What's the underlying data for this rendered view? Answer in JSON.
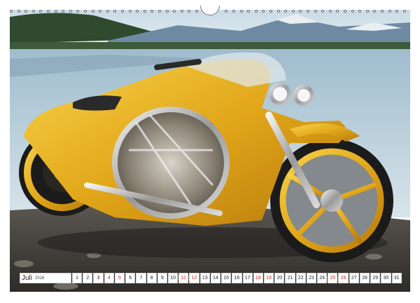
{
  "calendar": {
    "month": "Juli",
    "year": "2026",
    "days": [
      {
        "n": "1",
        "red": false
      },
      {
        "n": "2",
        "red": false
      },
      {
        "n": "3",
        "red": false
      },
      {
        "n": "4",
        "red": true
      },
      {
        "n": "5",
        "red": true
      },
      {
        "n": "6",
        "red": false
      },
      {
        "n": "7",
        "red": false
      },
      {
        "n": "8",
        "red": false
      },
      {
        "n": "9",
        "red": false
      },
      {
        "n": "10",
        "red": false
      },
      {
        "n": "11",
        "red": true
      },
      {
        "n": "12",
        "red": true
      },
      {
        "n": "13",
        "red": false
      },
      {
        "n": "14",
        "red": false
      },
      {
        "n": "15",
        "red": false
      },
      {
        "n": "16",
        "red": false
      },
      {
        "n": "17",
        "red": false
      },
      {
        "n": "18",
        "red": true
      },
      {
        "n": "19",
        "red": true
      },
      {
        "n": "20",
        "red": false
      },
      {
        "n": "21",
        "red": false
      },
      {
        "n": "22",
        "red": false
      },
      {
        "n": "23",
        "red": false
      },
      {
        "n": "24",
        "red": false
      },
      {
        "n": "25",
        "red": true
      },
      {
        "n": "26",
        "red": true
      },
      {
        "n": "27",
        "red": false
      },
      {
        "n": "28",
        "red": false
      },
      {
        "n": "29",
        "red": false
      },
      {
        "n": "30",
        "red": false
      },
      {
        "n": "31",
        "red": false
      }
    ]
  },
  "colors": {
    "weekend": "#c62828",
    "motorcycle_body": "#e8b21c"
  },
  "photo": {
    "icon": "futuristic-yellow-motorcycle-photo"
  }
}
